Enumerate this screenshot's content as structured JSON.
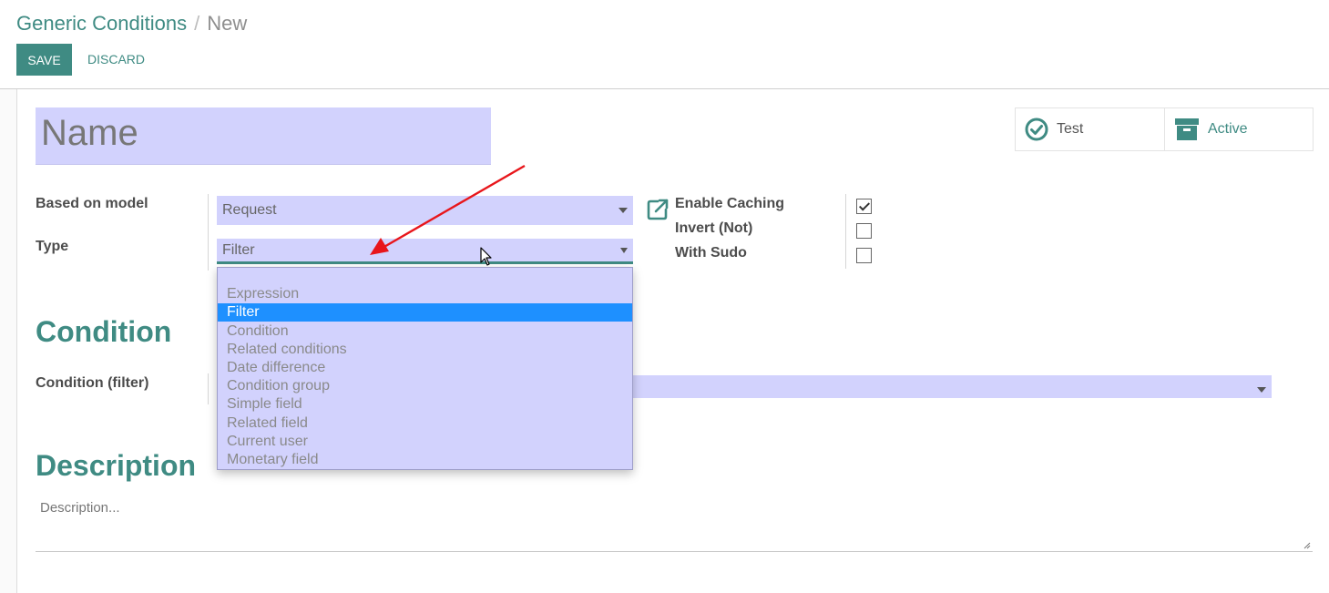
{
  "breadcrumb": {
    "parent": "Generic Conditions",
    "separator": "/",
    "current": "New"
  },
  "toolbar": {
    "save_label": "SAVE",
    "discard_label": "DISCARD"
  },
  "form": {
    "name_placeholder": "Name",
    "stat_buttons": [
      {
        "label": "Test",
        "icon": "check-circle-icon",
        "color": "#3f8b83"
      },
      {
        "label": "Active",
        "icon": "archive-icon",
        "color": "#3f8b83"
      }
    ],
    "fields": {
      "based_on_model": {
        "label": "Based on model",
        "value": "Request"
      },
      "type": {
        "label": "Type",
        "value": "Filter",
        "options": [
          "Expression",
          "Filter",
          "Condition",
          "Related conditions",
          "Date difference",
          "Condition group",
          "Simple field",
          "Related field",
          "Current user",
          "Monetary field"
        ],
        "selected_index": 1
      },
      "enable_caching": {
        "label": "Enable Caching",
        "checked": true
      },
      "invert": {
        "label": "Invert (Not)",
        "checked": false
      },
      "with_sudo": {
        "label": "With Sudo",
        "checked": false
      }
    },
    "condition_section": {
      "title": "Condition",
      "filter_label": "Condition (filter)"
    },
    "description_section": {
      "title": "Description",
      "placeholder": "Description..."
    }
  },
  "colors": {
    "accent": "#3f8b83",
    "input_bg": "#d2d2fd",
    "selected_option": "#1e90ff",
    "annotation_arrow": "#e8161b"
  }
}
